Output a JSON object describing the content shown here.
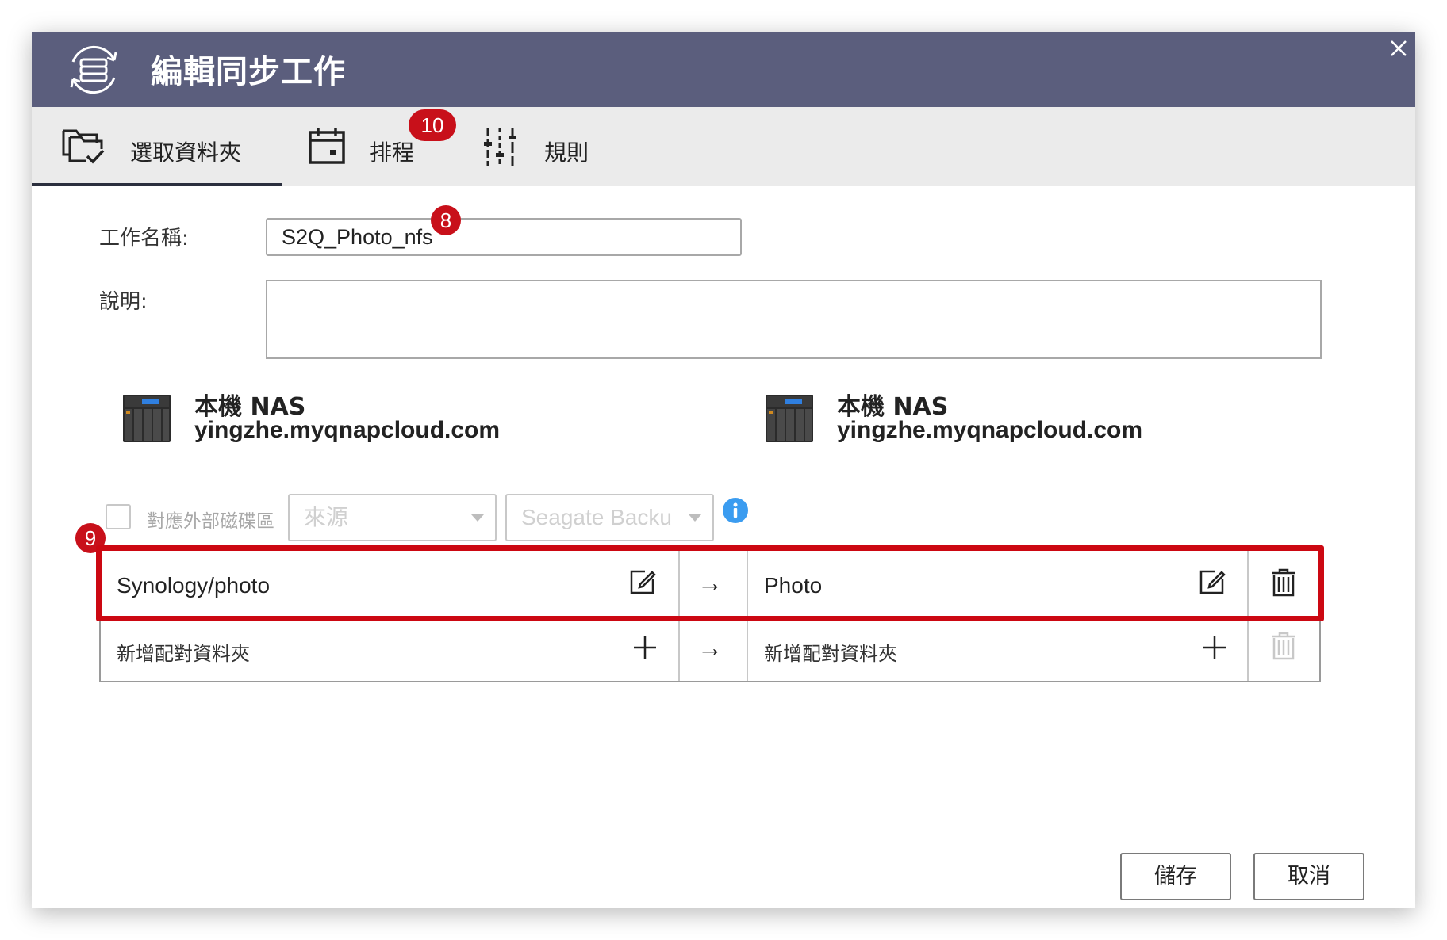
{
  "dialog": {
    "title": "編輯同步工作",
    "title_icon": "sync-server-icon",
    "close_icon": "close-icon"
  },
  "tabs": [
    {
      "label": "選取資料夾",
      "icon": "folder-check-icon",
      "active": true
    },
    {
      "label": "排程",
      "icon": "calendar-icon",
      "active": false
    },
    {
      "label": "規則",
      "icon": "sliders-icon",
      "active": false
    }
  ],
  "annotations": {
    "badge_schedule": "10",
    "badge_name": "8",
    "badge_table": "9"
  },
  "form": {
    "job_name_label": "工作名稱:",
    "job_name_value": "S2Q_Photo_nfs",
    "description_label": "說明:",
    "description_value": ""
  },
  "source": {
    "title": "本機 NAS",
    "host": "yingzhe.myqnapcloud.com",
    "icon": "nas-device-icon"
  },
  "destination": {
    "title": "本機 NAS",
    "host": "yingzhe.myqnapcloud.com",
    "icon": "nas-device-icon"
  },
  "external": {
    "checkbox_label": "對應外部磁碟區",
    "source_select": "來源",
    "dest_select": "Seagate Backu",
    "info_icon": "info-icon"
  },
  "pairs": [
    {
      "source": "Synology/photo",
      "dest": "Photo",
      "arrow": "→"
    }
  ],
  "add_row": {
    "source_placeholder": "新增配對資料夾",
    "dest_placeholder": "新增配對資料夾",
    "arrow": "→"
  },
  "buttons": {
    "save": "儲存",
    "cancel": "取消"
  },
  "colors": {
    "titlebar": "#5b5e7d",
    "tabbar": "#ebebeb",
    "highlight": "#cc0812",
    "info": "#3b9cf0"
  }
}
